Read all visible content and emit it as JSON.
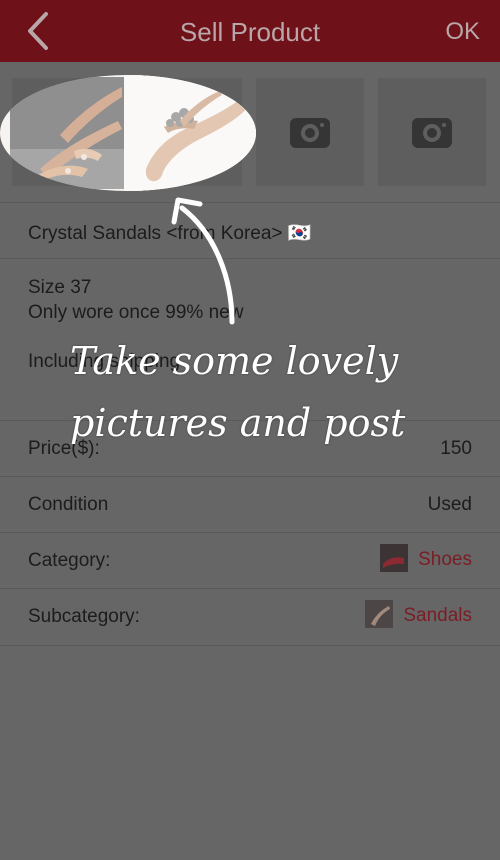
{
  "header": {
    "title": "Sell Product",
    "ok_label": "OK",
    "back_icon": "chevron-left-icon",
    "bar_color": "#6e1119"
  },
  "photos": {
    "empty_slot_icon": "camera-icon",
    "slots": 4
  },
  "description": {
    "title_line": "Crystal Sandals <from Korea> 🇰🇷",
    "line1": "Size 37",
    "line2": "Only wore once 99% new",
    "line3": "Including shipping"
  },
  "fields": {
    "price_label": "Price($):",
    "price_value": "150",
    "condition_label": "Condition",
    "condition_value": "Used",
    "category_label": "Category:",
    "category_value": "Shoes",
    "subcategory_label": "Subcategory:",
    "subcategory_value": "Sandals"
  },
  "overlay": {
    "line1": "Take some lovely",
    "line2": "pictures and post"
  },
  "colors": {
    "accent": "#7a1d25",
    "dim_overlay": "#666666"
  }
}
